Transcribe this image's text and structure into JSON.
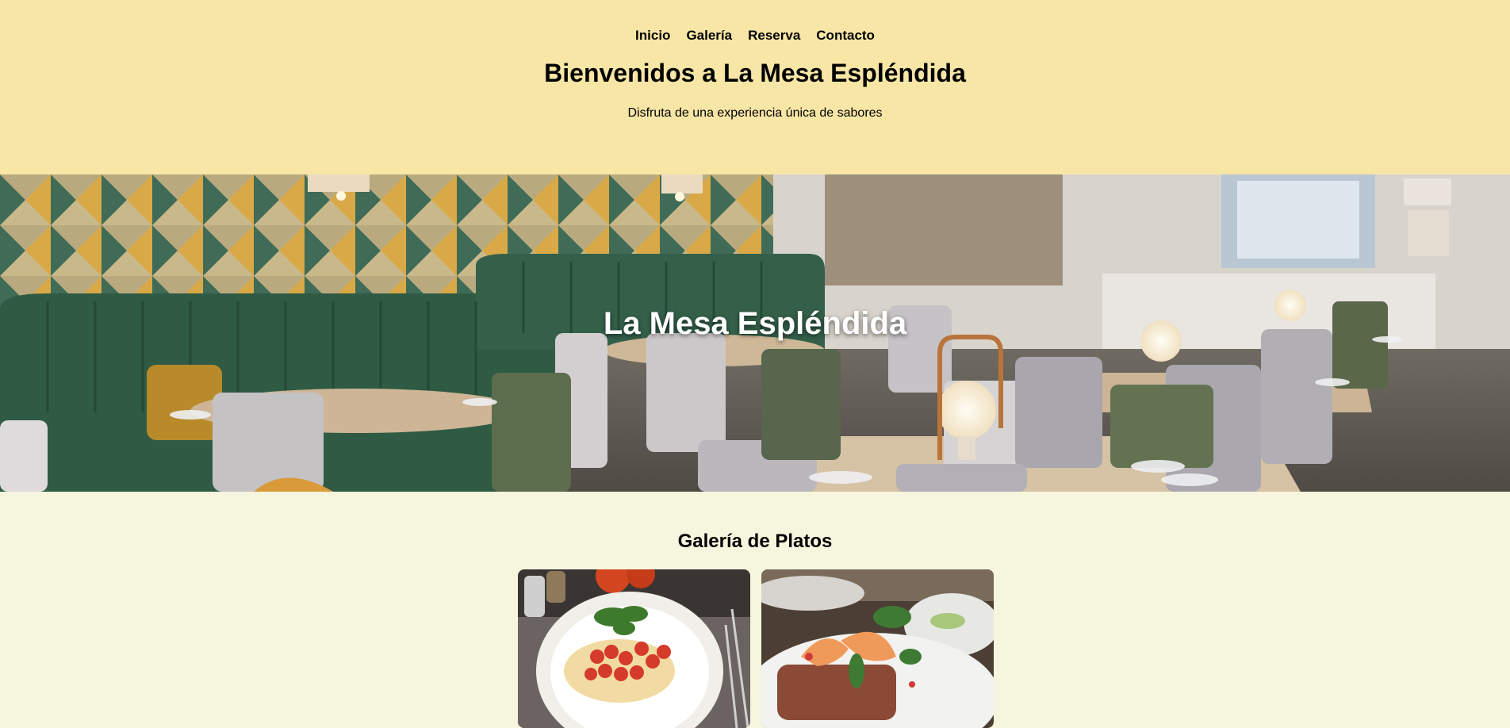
{
  "nav": {
    "items": [
      {
        "label": "Inicio"
      },
      {
        "label": "Galería"
      },
      {
        "label": "Reserva"
      },
      {
        "label": "Contacto"
      }
    ]
  },
  "header": {
    "title": "Bienvenidos a La Mesa Espléndida",
    "tagline": "Disfruta de una experiencia única de sabores"
  },
  "hero": {
    "title": "La Mesa Espléndida"
  },
  "gallery": {
    "title": "Galería de Platos",
    "items": [
      {
        "image": "bruschetta-plate-photo"
      },
      {
        "image": "shrimp-steak-plate-photo"
      }
    ]
  },
  "colors": {
    "header_bg": "#f8e6a6",
    "page_bg": "#f6f5de",
    "text": "#000000",
    "hero_title": "#ffffff"
  }
}
